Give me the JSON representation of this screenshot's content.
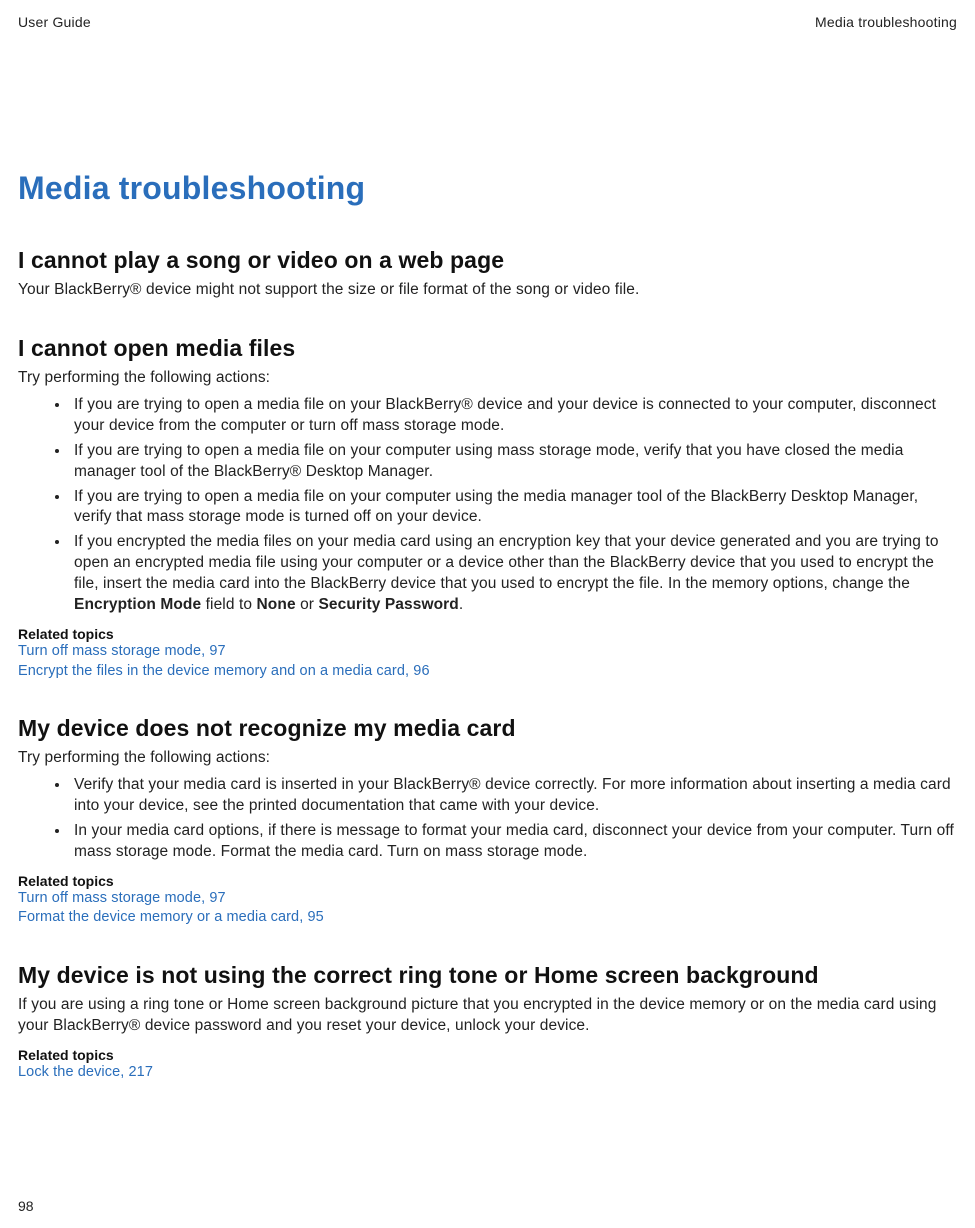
{
  "header": {
    "left": "User Guide",
    "right": "Media troubleshooting"
  },
  "title": "Media troubleshooting",
  "section1": {
    "heading": "I cannot play a song or video on a web page",
    "para": "Your BlackBerry® device might not support the size or file format of the song or video file."
  },
  "section2": {
    "heading": "I cannot open media files",
    "intro": "Try performing the following actions:",
    "bullets": [
      "If you are trying to open a media file on your BlackBerry® device and your device is connected to your computer, disconnect your device from the computer or turn off mass storage mode.",
      "If you are trying to open a media file on your computer using mass storage mode, verify that you have closed the media manager tool of the BlackBerry® Desktop Manager.",
      "If you are trying to open a media file on your computer using the media manager tool of the BlackBerry Desktop Manager, verify that mass storage mode is turned off on your device."
    ],
    "bullet4_parts": {
      "p1": "If you encrypted the media files on your media card using an encryption key that your device generated and you are trying to open an encrypted media file using your computer or a device other than the BlackBerry device that you used to encrypt the file, insert the media card into the BlackBerry device that you used to encrypt the file. In the memory options, change the ",
      "b1": "Encryption Mode",
      "p2": " field to ",
      "b2": "None",
      "p3": " or ",
      "b3": "Security Password",
      "p4": "."
    },
    "related_label": "Related topics",
    "links": [
      "Turn off mass storage mode, 97",
      "Encrypt the files in the device memory and on a media card, 96"
    ]
  },
  "section3": {
    "heading": "My device does not recognize my media card",
    "intro": "Try performing the following actions:",
    "bullets": [
      "Verify that your media card is inserted in your BlackBerry® device correctly. For more information about inserting a media card into your device, see the printed documentation that came with your device.",
      "In your media card options, if there is message to format your media card, disconnect your device from your computer. Turn off mass storage mode. Format the media card. Turn on mass storage mode."
    ],
    "related_label": "Related topics",
    "links": [
      "Turn off mass storage mode, 97",
      "Format the device memory or a media card, 95"
    ]
  },
  "section4": {
    "heading": "My device is not using the correct ring tone or Home screen background",
    "para": "If you are using a ring tone or Home screen background picture that you encrypted in the device memory or on the media card using your BlackBerry® device password and you reset your device, unlock your device.",
    "related_label": "Related topics",
    "links": [
      "Lock the device, 217"
    ]
  },
  "page_number": "98"
}
